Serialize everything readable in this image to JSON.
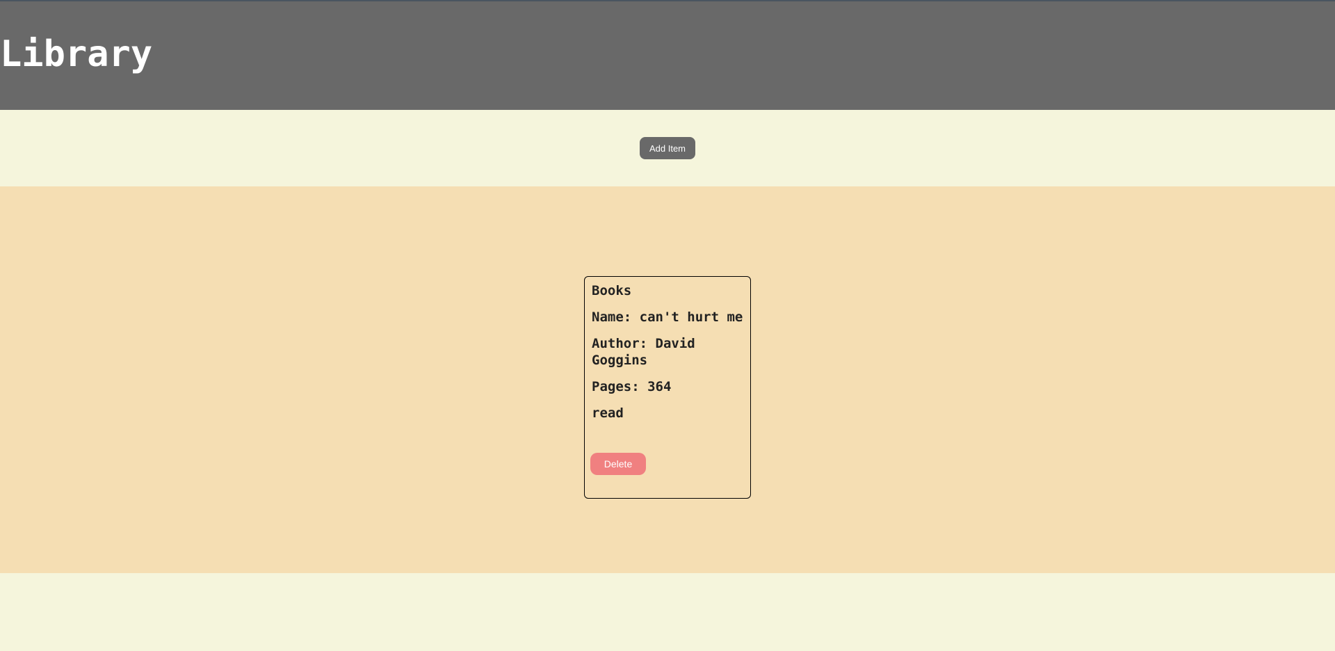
{
  "header": {
    "title": "Library"
  },
  "toolbar": {
    "add_label": "Add Item"
  },
  "library": {
    "cards": [
      {
        "category": "Books",
        "name": "Name: can't hurt me",
        "author": "Author: David Goggins",
        "pages": "Pages: 364",
        "status": "read",
        "delete_label": "Delete"
      }
    ]
  },
  "colors": {
    "header_bg": "#696969",
    "page_bg": "#f5f5dc",
    "library_bg": "#f5deb3",
    "delete_bg": "#f08080",
    "button_bg": "#696969"
  }
}
